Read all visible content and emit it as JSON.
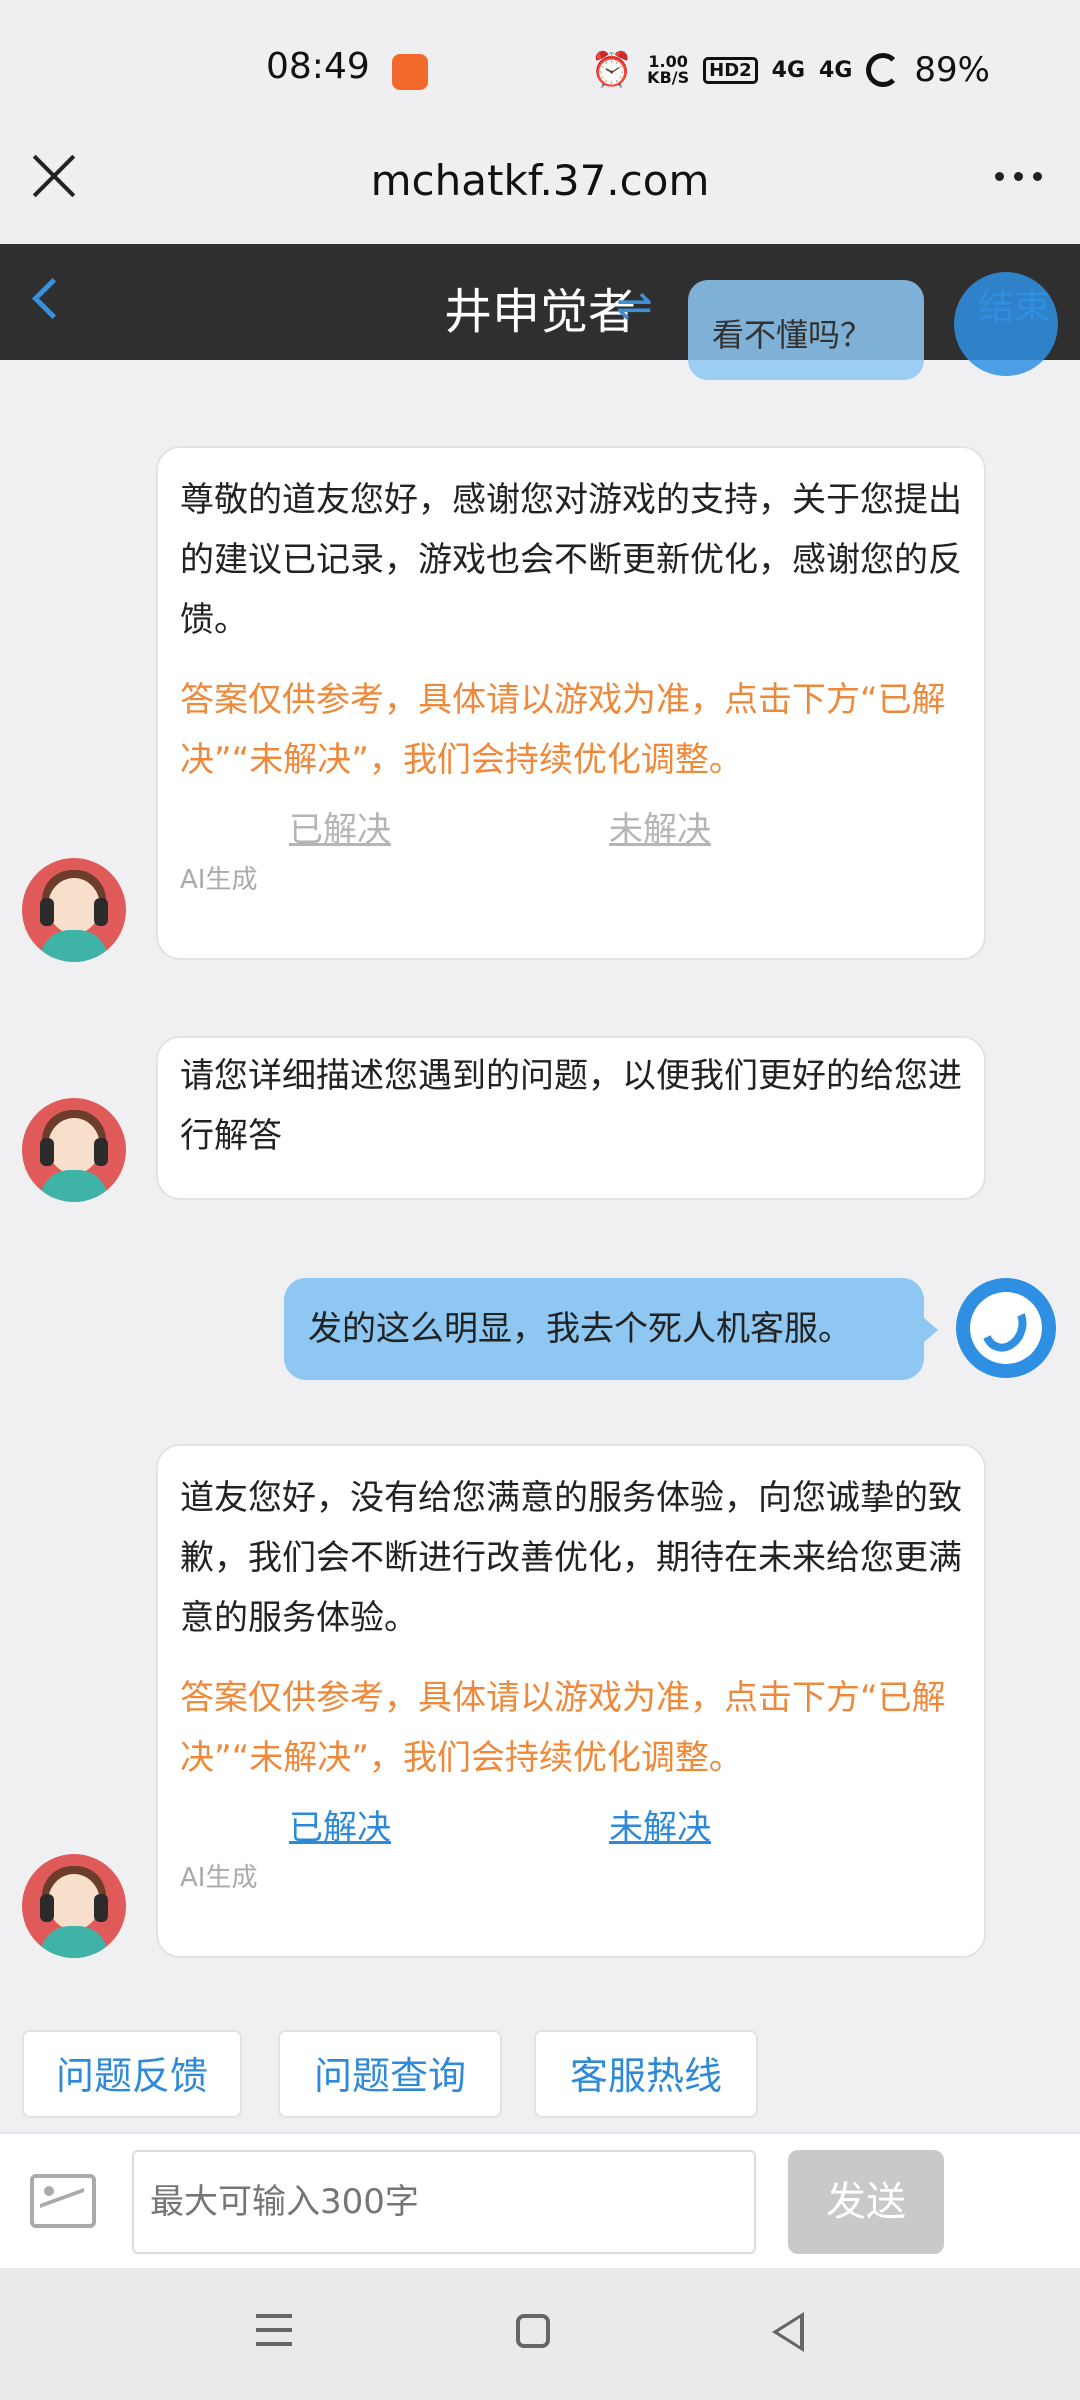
{
  "status_bar": {
    "time": "08:49",
    "net_speed_value": "1.00",
    "net_speed_unit": "KB/S",
    "hd_badge": "HD2",
    "signal1": "4G",
    "signal2": "4G",
    "battery": "89%"
  },
  "browser": {
    "url": "mchatkf.37.com"
  },
  "header": {
    "title": "井申觉者",
    "swap_glyph": "⇌",
    "end_label": "结束"
  },
  "overlay": {
    "text": "看不懂吗？"
  },
  "messages": [
    {
      "text": "尊敬的道友您好，感谢您对游戏的支持，关于您提出的建议已记录，游戏也会不断更新优化，感谢您的反馈。",
      "note": "答案仅供参考，具体请以游戏为准，点击下方“已解决”“未解决”，我们会持续优化调整。",
      "resolved_label": "已解决",
      "unresolved_label": "未解决",
      "ai_tag": "AI生成"
    },
    {
      "text": "请您详细描述您遇到的问题，以便我们更好的给您进行解答"
    },
    {
      "text": "发的这么明显，我去个死人机客服。"
    },
    {
      "text": "道友您好，没有给您满意的服务体验，向您诚挚的致歉，我们会不断进行改善优化，期待在未来给您更满意的服务体验。",
      "note": "答案仅供参考，具体请以游戏为准，点击下方“已解决”“未解决”，我们会持续优化调整。",
      "resolved_label": "已解决",
      "unresolved_label": "未解决",
      "ai_tag": "AI生成"
    }
  ],
  "quick_buttons": [
    "问题反馈",
    "问题查询",
    "客服热线"
  ],
  "input": {
    "placeholder": "最大可输入300字",
    "send_label": "发送"
  },
  "colors": {
    "accent": "#2e8ad8",
    "note": "#f0883a",
    "my_bubble": "#8ec7f2"
  }
}
